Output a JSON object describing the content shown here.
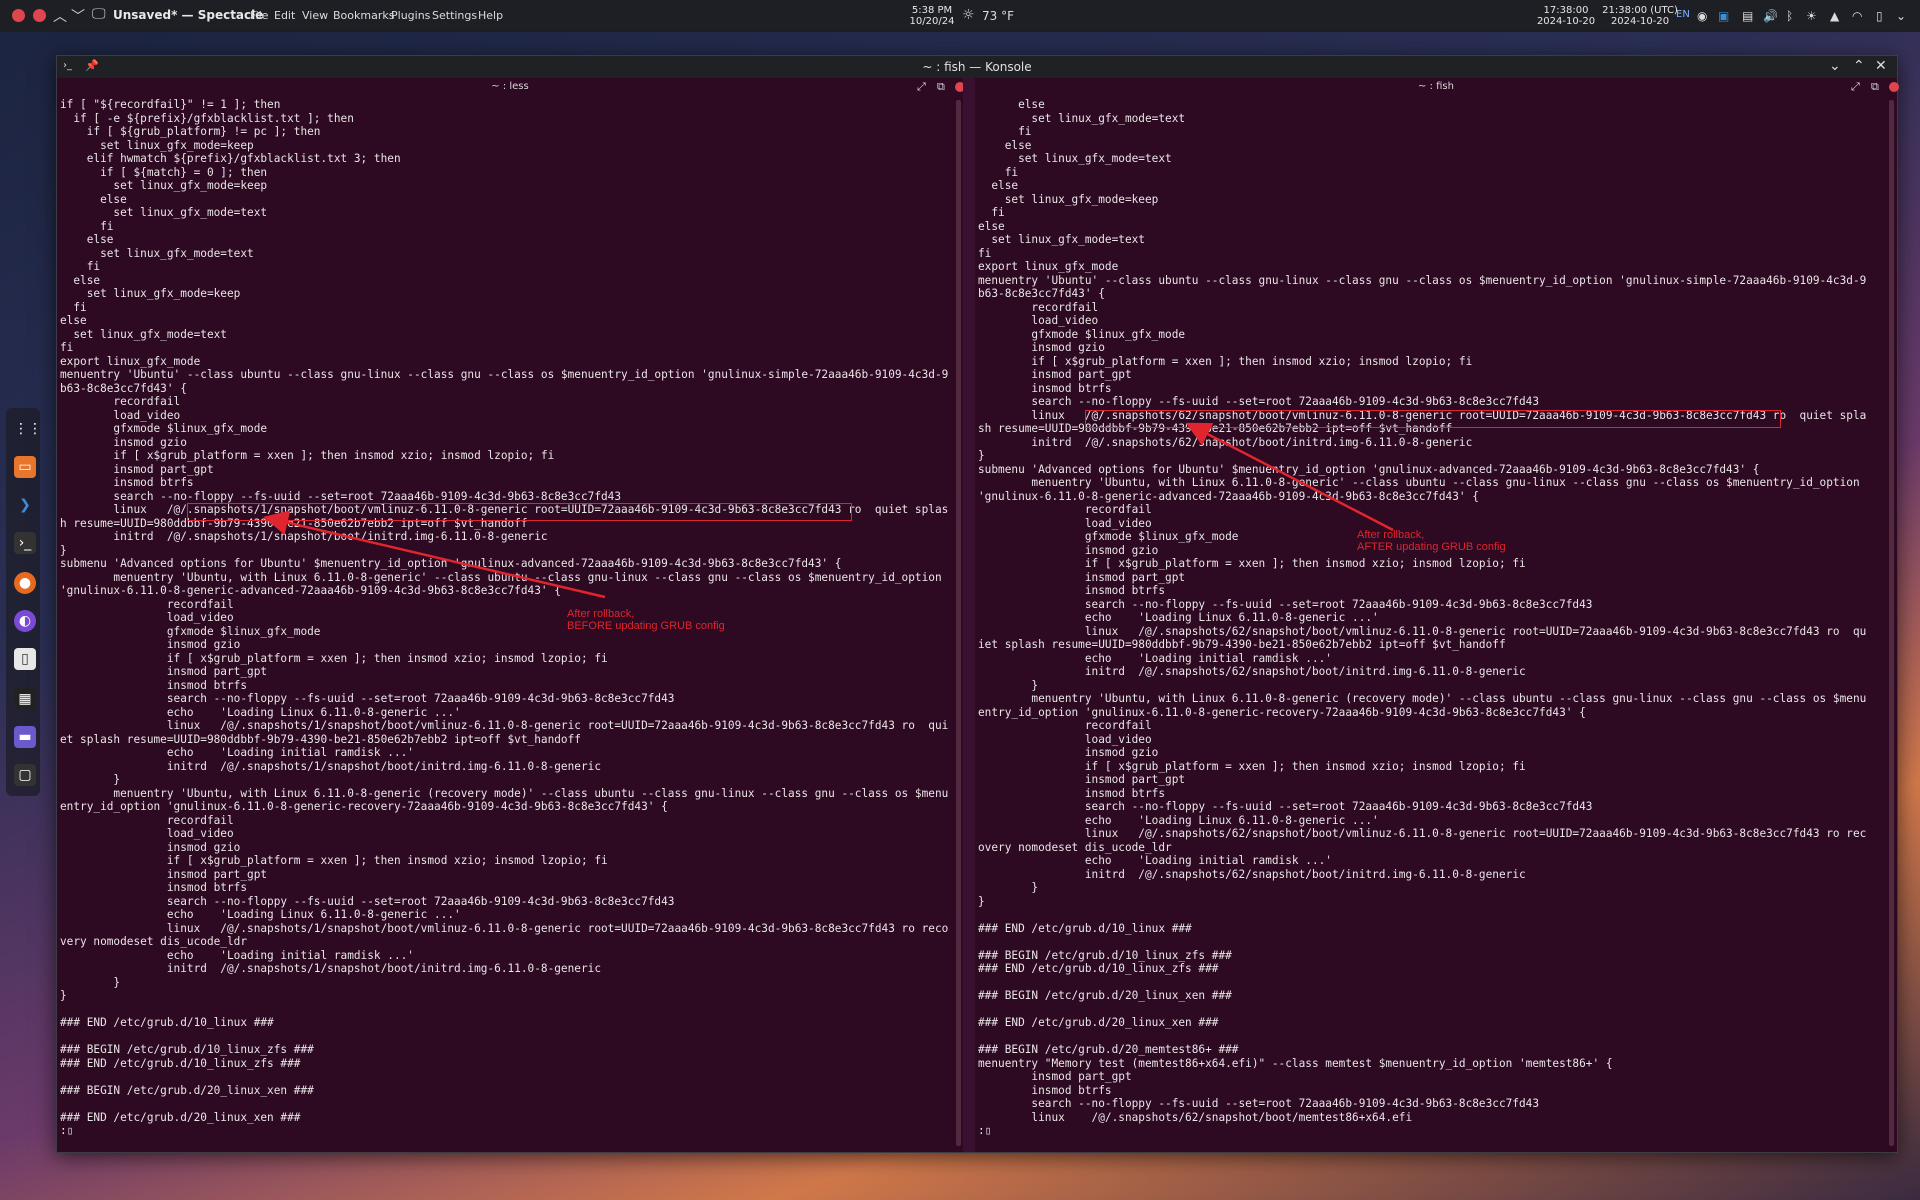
{
  "topbar": {
    "app_title": "Unsaved* — Spectacle",
    "menus": [
      "File",
      "Edit",
      "View",
      "Bookmarks",
      "Plugins",
      "Settings",
      "Help"
    ],
    "center_time": "5:38 PM",
    "center_date": "10/20/24",
    "weather": "73 °F",
    "clock_left_time": "17:38:00",
    "clock_left_date": "2024-10-20",
    "clock_utc_time": "21:38:00 (UTC)",
    "clock_utc_date": "2024-10-20",
    "lang": "EN"
  },
  "window": {
    "title": "~ : fish — Konsole"
  },
  "left_pane": {
    "header": "~ : less",
    "lines": [
      "if [ \"${recordfail}\" != 1 ]; then",
      "  if [ -e ${prefix}/gfxblacklist.txt ]; then",
      "    if [ ${grub_platform} != pc ]; then",
      "      set linux_gfx_mode=keep",
      "    elif hwmatch ${prefix}/gfxblacklist.txt 3; then",
      "      if [ ${match} = 0 ]; then",
      "        set linux_gfx_mode=keep",
      "      else",
      "        set linux_gfx_mode=text",
      "      fi",
      "    else",
      "      set linux_gfx_mode=text",
      "    fi",
      "  else",
      "    set linux_gfx_mode=keep",
      "  fi",
      "else",
      "  set linux_gfx_mode=text",
      "fi",
      "export linux_gfx_mode",
      "menuentry 'Ubuntu' --class ubuntu --class gnu-linux --class gnu --class os $menuentry_id_option 'gnulinux-simple-72aaa46b-9109-4c3d-9",
      "b63-8c8e3cc7fd43' {",
      "        recordfail",
      "        load_video",
      "        gfxmode $linux_gfx_mode",
      "        insmod gzio",
      "        if [ x$grub_platform = xxen ]; then insmod xzio; insmod lzopio; fi",
      "        insmod part_gpt",
      "        insmod btrfs",
      "        search --no-floppy --fs-uuid --set=root 72aaa46b-9109-4c3d-9b63-8c8e3cc7fd43",
      "        linux   /@/.snapshots/1/snapshot/boot/vmlinuz-6.11.0-8-generic root=UUID=72aaa46b-9109-4c3d-9b63-8c8e3cc7fd43 ro  quiet splas",
      "h resume=UUID=980ddbbf-9b79-4390-be21-850e62b7ebb2 ipt=off $vt_handoff",
      "        initrd  /@/.snapshots/1/snapshot/boot/initrd.img-6.11.0-8-generic",
      "}",
      "submenu 'Advanced options for Ubuntu' $menuentry_id_option 'gnulinux-advanced-72aaa46b-9109-4c3d-9b63-8c8e3cc7fd43' {",
      "        menuentry 'Ubuntu, with Linux 6.11.0-8-generic' --class ubuntu --class gnu-linux --class gnu --class os $menuentry_id_option",
      "'gnulinux-6.11.0-8-generic-advanced-72aaa46b-9109-4c3d-9b63-8c8e3cc7fd43' {",
      "                recordfail",
      "                load_video",
      "                gfxmode $linux_gfx_mode",
      "                insmod gzio",
      "                if [ x$grub_platform = xxen ]; then insmod xzio; insmod lzopio; fi",
      "                insmod part_gpt",
      "                insmod btrfs",
      "                search --no-floppy --fs-uuid --set=root 72aaa46b-9109-4c3d-9b63-8c8e3cc7fd43",
      "                echo    'Loading Linux 6.11.0-8-generic ...'",
      "                linux   /@/.snapshots/1/snapshot/boot/vmlinuz-6.11.0-8-generic root=UUID=72aaa46b-9109-4c3d-9b63-8c8e3cc7fd43 ro  qui",
      "et splash resume=UUID=980ddbbf-9b79-4390-be21-850e62b7ebb2 ipt=off $vt_handoff",
      "                echo    'Loading initial ramdisk ...'",
      "                initrd  /@/.snapshots/1/snapshot/boot/initrd.img-6.11.0-8-generic",
      "        }",
      "        menuentry 'Ubuntu, with Linux 6.11.0-8-generic (recovery mode)' --class ubuntu --class gnu-linux --class gnu --class os $menu",
      "entry_id_option 'gnulinux-6.11.0-8-generic-recovery-72aaa46b-9109-4c3d-9b63-8c8e3cc7fd43' {",
      "                recordfail",
      "                load_video",
      "                insmod gzio",
      "                if [ x$grub_platform = xxen ]; then insmod xzio; insmod lzopio; fi",
      "                insmod part_gpt",
      "                insmod btrfs",
      "                search --no-floppy --fs-uuid --set=root 72aaa46b-9109-4c3d-9b63-8c8e3cc7fd43",
      "                echo    'Loading Linux 6.11.0-8-generic ...'",
      "                linux   /@/.snapshots/1/snapshot/boot/vmlinuz-6.11.0-8-generic root=UUID=72aaa46b-9109-4c3d-9b63-8c8e3cc7fd43 ro reco",
      "very nomodeset dis_ucode_ldr",
      "                echo    'Loading initial ramdisk ...'",
      "                initrd  /@/.snapshots/1/snapshot/boot/initrd.img-6.11.0-8-generic",
      "        }",
      "}",
      "",
      "### END /etc/grub.d/10_linux ###",
      "",
      "### BEGIN /etc/grub.d/10_linux_zfs ###",
      "### END /etc/grub.d/10_linux_zfs ###",
      "",
      "### BEGIN /etc/grub.d/20_linux_xen ###",
      "",
      "### END /etc/grub.d/20_linux_xen ###",
      ":▯"
    ],
    "annotation_line1": "After rollback,",
    "annotation_line2": "BEFORE updating GRUB config"
  },
  "right_pane": {
    "header": "~ : fish",
    "lines": [
      "      else",
      "        set linux_gfx_mode=text",
      "      fi",
      "    else",
      "      set linux_gfx_mode=text",
      "    fi",
      "  else",
      "    set linux_gfx_mode=keep",
      "  fi",
      "else",
      "  set linux_gfx_mode=text",
      "fi",
      "export linux_gfx_mode",
      "menuentry 'Ubuntu' --class ubuntu --class gnu-linux --class gnu --class os $menuentry_id_option 'gnulinux-simple-72aaa46b-9109-4c3d-9",
      "b63-8c8e3cc7fd43' {",
      "        recordfail",
      "        load_video",
      "        gfxmode $linux_gfx_mode",
      "        insmod gzio",
      "        if [ x$grub_platform = xxen ]; then insmod xzio; insmod lzopio; fi",
      "        insmod part_gpt",
      "        insmod btrfs",
      "        search --no-floppy --fs-uuid --set=root 72aaa46b-9109-4c3d-9b63-8c8e3cc7fd43",
      "        linux   /@/.snapshots/62/snapshot/boot/vmlinuz-6.11.0-8-generic root=UUID=72aaa46b-9109-4c3d-9b63-8c8e3cc7fd43 ro  quiet spla",
      "sh resume=UUID=980ddbbf-9b79-4390-be21-850e62b7ebb2 ipt=off $vt_handoff",
      "        initrd  /@/.snapshots/62/snapshot/boot/initrd.img-6.11.0-8-generic",
      "}",
      "submenu 'Advanced options for Ubuntu' $menuentry_id_option 'gnulinux-advanced-72aaa46b-9109-4c3d-9b63-8c8e3cc7fd43' {",
      "        menuentry 'Ubuntu, with Linux 6.11.0-8-generic' --class ubuntu --class gnu-linux --class gnu --class os $menuentry_id_option",
      "'gnulinux-6.11.0-8-generic-advanced-72aaa46b-9109-4c3d-9b63-8c8e3cc7fd43' {",
      "                recordfail",
      "                load_video",
      "                gfxmode $linux_gfx_mode",
      "                insmod gzio",
      "                if [ x$grub_platform = xxen ]; then insmod xzio; insmod lzopio; fi",
      "                insmod part_gpt",
      "                insmod btrfs",
      "                search --no-floppy --fs-uuid --set=root 72aaa46b-9109-4c3d-9b63-8c8e3cc7fd43",
      "                echo    'Loading Linux 6.11.0-8-generic ...'",
      "                linux   /@/.snapshots/62/snapshot/boot/vmlinuz-6.11.0-8-generic root=UUID=72aaa46b-9109-4c3d-9b63-8c8e3cc7fd43 ro  qu",
      "iet splash resume=UUID=980ddbbf-9b79-4390-be21-850e62b7ebb2 ipt=off $vt_handoff",
      "                echo    'Loading initial ramdisk ...'",
      "                initrd  /@/.snapshots/62/snapshot/boot/initrd.img-6.11.0-8-generic",
      "        }",
      "        menuentry 'Ubuntu, with Linux 6.11.0-8-generic (recovery mode)' --class ubuntu --class gnu-linux --class gnu --class os $menu",
      "entry_id_option 'gnulinux-6.11.0-8-generic-recovery-72aaa46b-9109-4c3d-9b63-8c8e3cc7fd43' {",
      "                recordfail",
      "                load_video",
      "                insmod gzio",
      "                if [ x$grub_platform = xxen ]; then insmod xzio; insmod lzopio; fi",
      "                insmod part_gpt",
      "                insmod btrfs",
      "                search --no-floppy --fs-uuid --set=root 72aaa46b-9109-4c3d-9b63-8c8e3cc7fd43",
      "                echo    'Loading Linux 6.11.0-8-generic ...'",
      "                linux   /@/.snapshots/62/snapshot/boot/vmlinuz-6.11.0-8-generic root=UUID=72aaa46b-9109-4c3d-9b63-8c8e3cc7fd43 ro rec",
      "overy nomodeset dis_ucode_ldr",
      "                echo    'Loading initial ramdisk ...'",
      "                initrd  /@/.snapshots/62/snapshot/boot/initrd.img-6.11.0-8-generic",
      "        }",
      "}",
      "",
      "### END /etc/grub.d/10_linux ###",
      "",
      "### BEGIN /etc/grub.d/10_linux_zfs ###",
      "### END /etc/grub.d/10_linux_zfs ###",
      "",
      "### BEGIN /etc/grub.d/20_linux_xen ###",
      "",
      "### END /etc/grub.d/20_linux_xen ###",
      "",
      "### BEGIN /etc/grub.d/20_memtest86+ ###",
      "menuentry \"Memory test (memtest86+x64.efi)\" --class memtest $menuentry_id_option 'memtest86+' {",
      "        insmod part_gpt",
      "        insmod btrfs",
      "        search --no-floppy --fs-uuid --set=root 72aaa46b-9109-4c3d-9b63-8c8e3cc7fd43",
      "        linux    /@/.snapshots/62/snapshot/boot/memtest86+x64.efi",
      ":▯"
    ],
    "annotation_line1": "After rollback,",
    "annotation_line2": "AFTER updating GRUB config"
  },
  "colors": {
    "terminal_bg": "#2d0922",
    "terminal_fg": "#e9e6e6",
    "annotation": "#e0252e"
  }
}
